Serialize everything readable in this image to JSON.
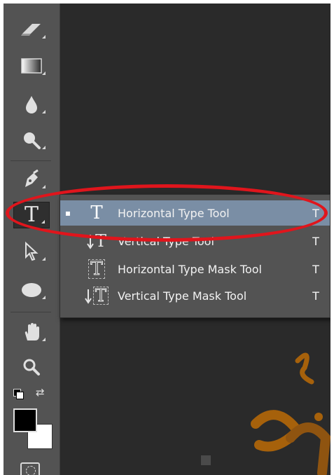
{
  "toolbar": {
    "tools": [
      {
        "name": "eraser-tool",
        "icon": "eraser-icon"
      },
      {
        "name": "gradient-tool",
        "icon": "gradient-icon"
      },
      {
        "name": "blur-tool",
        "icon": "drop-icon"
      },
      {
        "name": "dodge-tool",
        "icon": "dodge-icon"
      },
      {
        "name": "pen-tool",
        "icon": "pen-icon"
      },
      {
        "name": "type-tool",
        "icon": "type-icon",
        "glyph": "T",
        "active": true
      },
      {
        "name": "path-selection-tool",
        "icon": "arrow-icon"
      },
      {
        "name": "ellipse-tool",
        "icon": "ellipse-icon"
      },
      {
        "name": "hand-tool",
        "icon": "hand-icon"
      },
      {
        "name": "zoom-tool",
        "icon": "zoom-icon"
      }
    ],
    "colors": {
      "foreground": "#000000",
      "background": "#ffffff"
    }
  },
  "flyout": {
    "items": [
      {
        "label": "Horizontal Type Tool",
        "shortcut": "T",
        "selected": true,
        "icon": "horizontal-type-icon",
        "glyph": "T"
      },
      {
        "label": "Vertical Type Tool",
        "shortcut": "T",
        "selected": false,
        "icon": "vertical-type-icon",
        "glyph": "T"
      },
      {
        "label": "Horizontal Type Mask Tool",
        "shortcut": "T",
        "selected": false,
        "icon": "horizontal-type-mask-icon",
        "glyph": "T"
      },
      {
        "label": "Vertical Type Mask Tool",
        "shortcut": "T",
        "selected": false,
        "icon": "vertical-type-mask-icon",
        "glyph": "T"
      }
    ],
    "selected_marker": "▪"
  },
  "colors": {
    "highlight": "#e0151c",
    "selection": "#7a8ea5",
    "panel": "#535353",
    "canvas": "#2a2a2a",
    "accent_orange": "#a6610b"
  }
}
